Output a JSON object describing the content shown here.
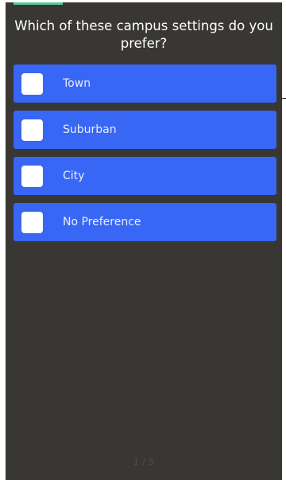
{
  "question": {
    "text": "Which of these campus settings do you prefer?"
  },
  "options": [
    {
      "label": "Town",
      "checked": false
    },
    {
      "label": "Suburban",
      "checked": false
    },
    {
      "label": "City",
      "checked": false
    },
    {
      "label": "No Preference",
      "checked": false
    }
  ],
  "pagination": {
    "text": "1 / 5"
  },
  "colors": {
    "background": "#383734",
    "option_background": "#3866f5",
    "accent": "#56c89c"
  }
}
